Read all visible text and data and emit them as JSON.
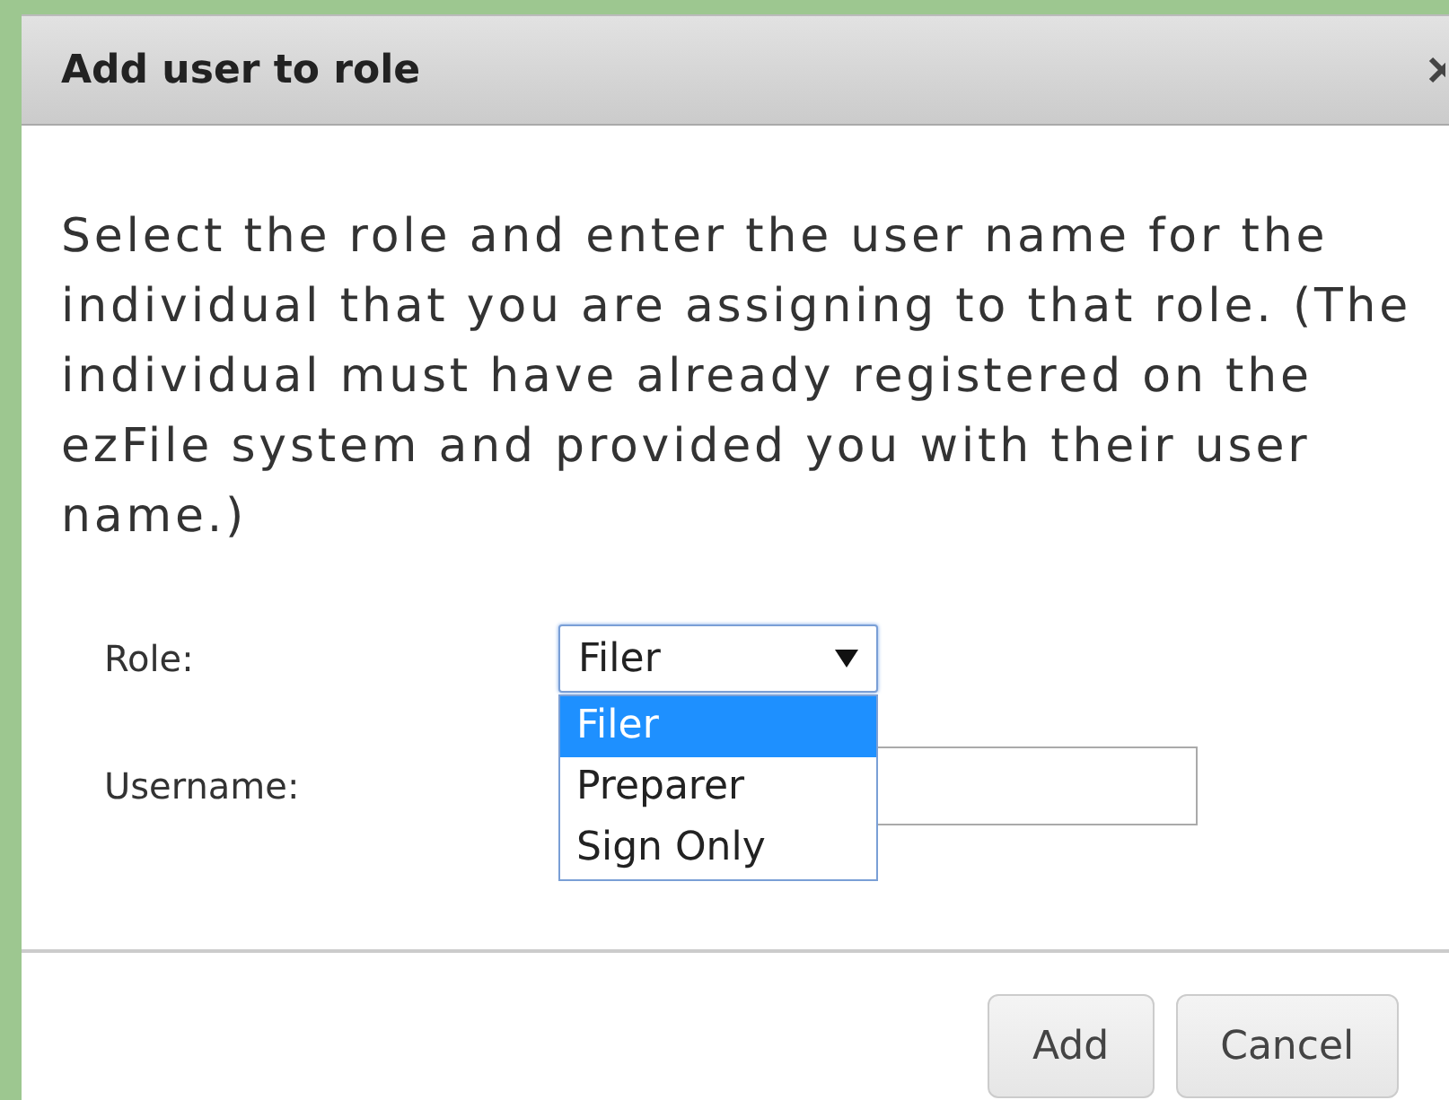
{
  "dialog": {
    "title": "Add user to role",
    "message": "Select the role and enter the user name for the individual that you are assigning to that role. (The individual must have already registered on the ezFile system and provided you with their user name.)",
    "fields": [
      {
        "kind": "select",
        "label": "Role:",
        "value": "Filer",
        "expanded": true,
        "options": [
          {
            "label": "Filer",
            "selected": true
          },
          {
            "label": "Preparer",
            "selected": false
          },
          {
            "label": "Sign Only",
            "selected": false
          }
        ]
      },
      {
        "kind": "text",
        "label": "Username:"
      }
    ],
    "buttons": [
      "Add",
      "Cancel"
    ]
  }
}
